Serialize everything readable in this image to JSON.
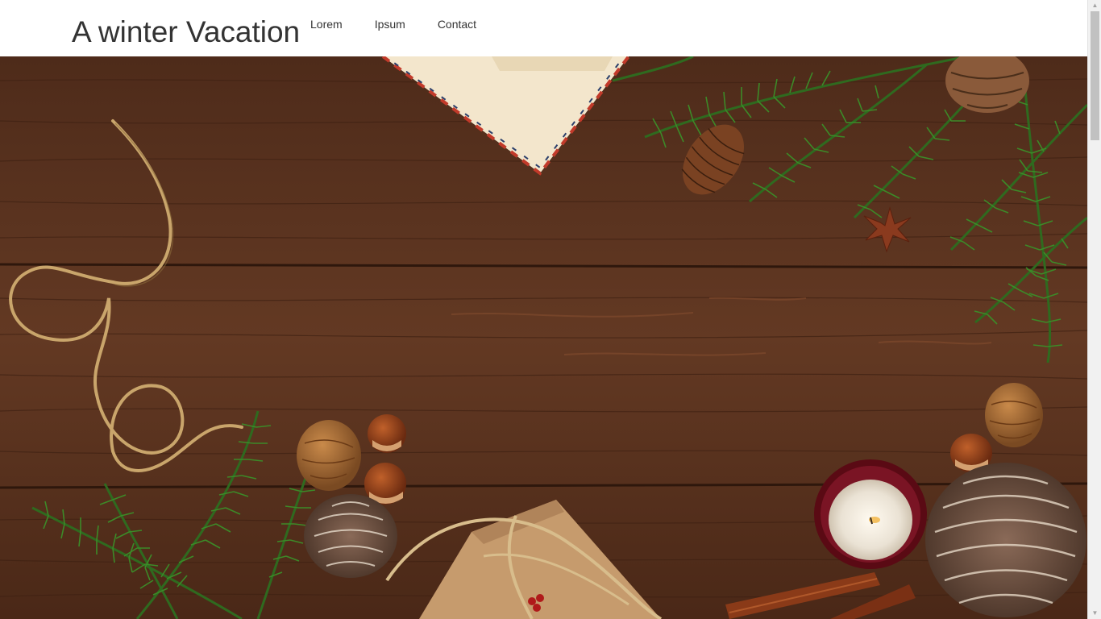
{
  "site": {
    "title": "A winter Vacation"
  },
  "nav": {
    "items": [
      {
        "label": "Lorem"
      },
      {
        "label": "Ipsum"
      },
      {
        "label": "Contact"
      }
    ]
  },
  "hero": {
    "scene": "wooden-table-christmas-decoration",
    "colors": {
      "wood": "#5a3320",
      "wood_light": "#6e412a",
      "fir": "#2f5a1e",
      "twine": "#c9a56b",
      "kraft": "#c69b6d"
    }
  },
  "scrollbar": {
    "up_icon": "scroll-up-arrow-icon",
    "down_icon": "scroll-down-arrow-icon"
  }
}
